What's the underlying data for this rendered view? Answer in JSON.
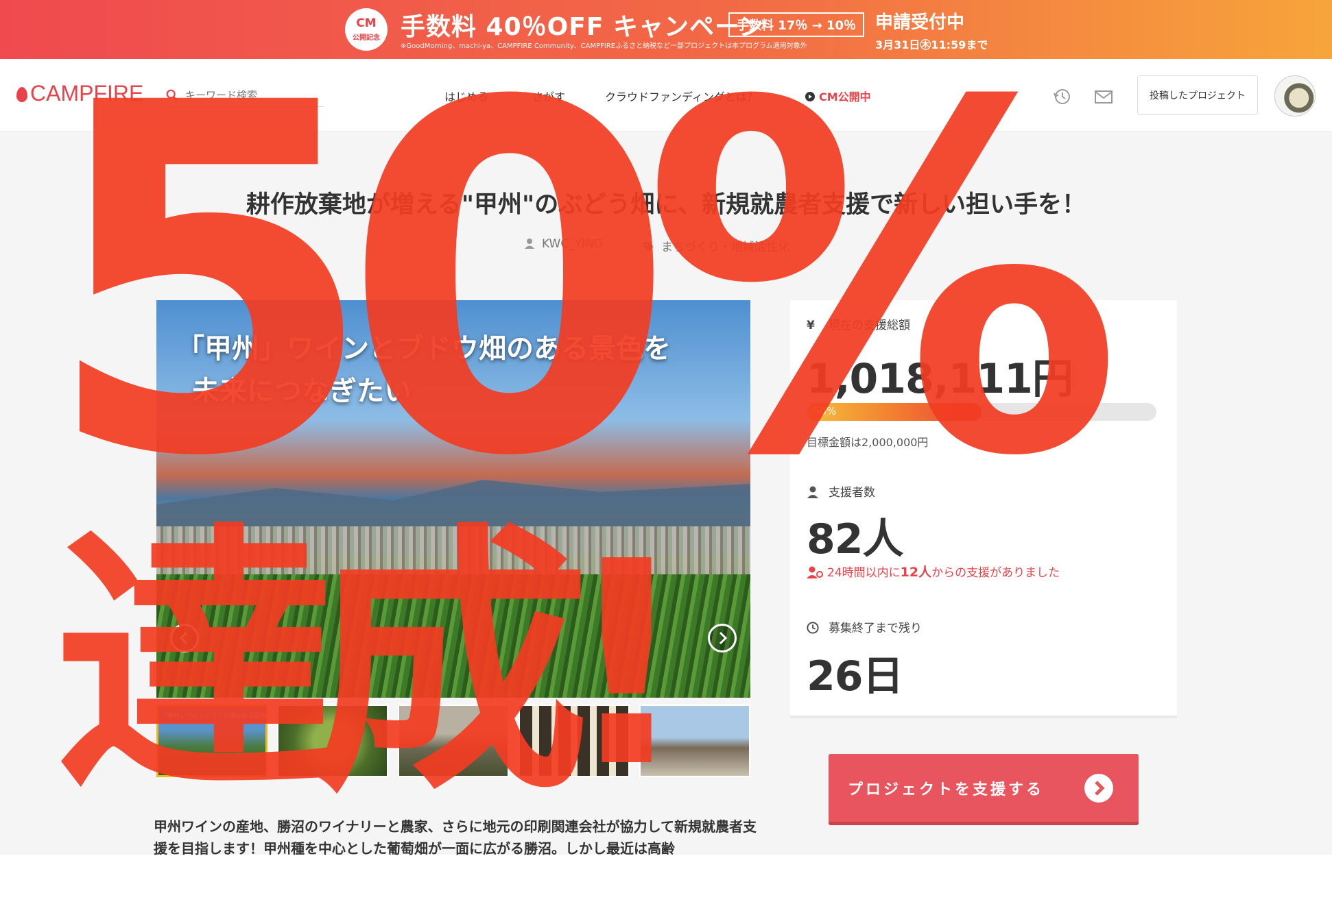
{
  "banner": {
    "badge_top": "CM",
    "badge_bottom": "公開記念",
    "headline": "手数料 40％OFF キャンペーン",
    "rate": "手数料 17％ → 10％",
    "note": "※GoodMorning、machi-ya、CAMPFIRE Community、CAMPFIREふるさと納税など一部プロジェクトは本プログラム適用対象外",
    "apply": "申請受付中",
    "deadline": "3月31日㊍11:59まで"
  },
  "header": {
    "logo": "CAMPFIRE",
    "search_placeholder": "キーワード検索",
    "nav": [
      "はじめる",
      "さがす",
      "クラウドファンディングとは？"
    ],
    "nav_cm": "CM公開中",
    "posted_button": "投稿したプロジェクト"
  },
  "project": {
    "title": "耕作放棄地が増える\"甲州\"のぶどう畑に、新規就農者支援で新しい担い手を！",
    "author": "KWC_YING",
    "category": "まちづくり・地域活性化",
    "image_caption_line1": "「甲州」ワインとブドウ畑のある景色を",
    "image_caption_line2": "未来につなぎたい",
    "thumb_caption": "「甲州」ワインとブドウ畑のある景色を",
    "description": "甲州ワインの産地、勝沼のワイナリーと農家、さらに地元の印刷関連会社が協力して新規就農者支援を目指します！甲州種を中心とした葡萄畑が一面に広がる勝沼。しかし最近は高齢"
  },
  "stats": {
    "total_label": "現在の支援総額",
    "total_value": "1,018,111円",
    "progress_percent": 50,
    "progress_text": "50%",
    "goal_text": "目標金額は2,000,000円",
    "backers_label": "支援者数",
    "backers_value": "82人",
    "recent_prefix": "24時間以内に",
    "recent_count": "12人",
    "recent_suffix": "からの支援がありました",
    "remaining_label": "募集終了まで残り",
    "remaining_value": "26日"
  },
  "support_button": "プロジェクトを支援する",
  "overlay": {
    "percent": "50%",
    "achieved": "達成!"
  },
  "colors": {
    "brand_red": "#e8434a",
    "overlay_red": "#f33c22",
    "button_red": "#e8555e"
  }
}
